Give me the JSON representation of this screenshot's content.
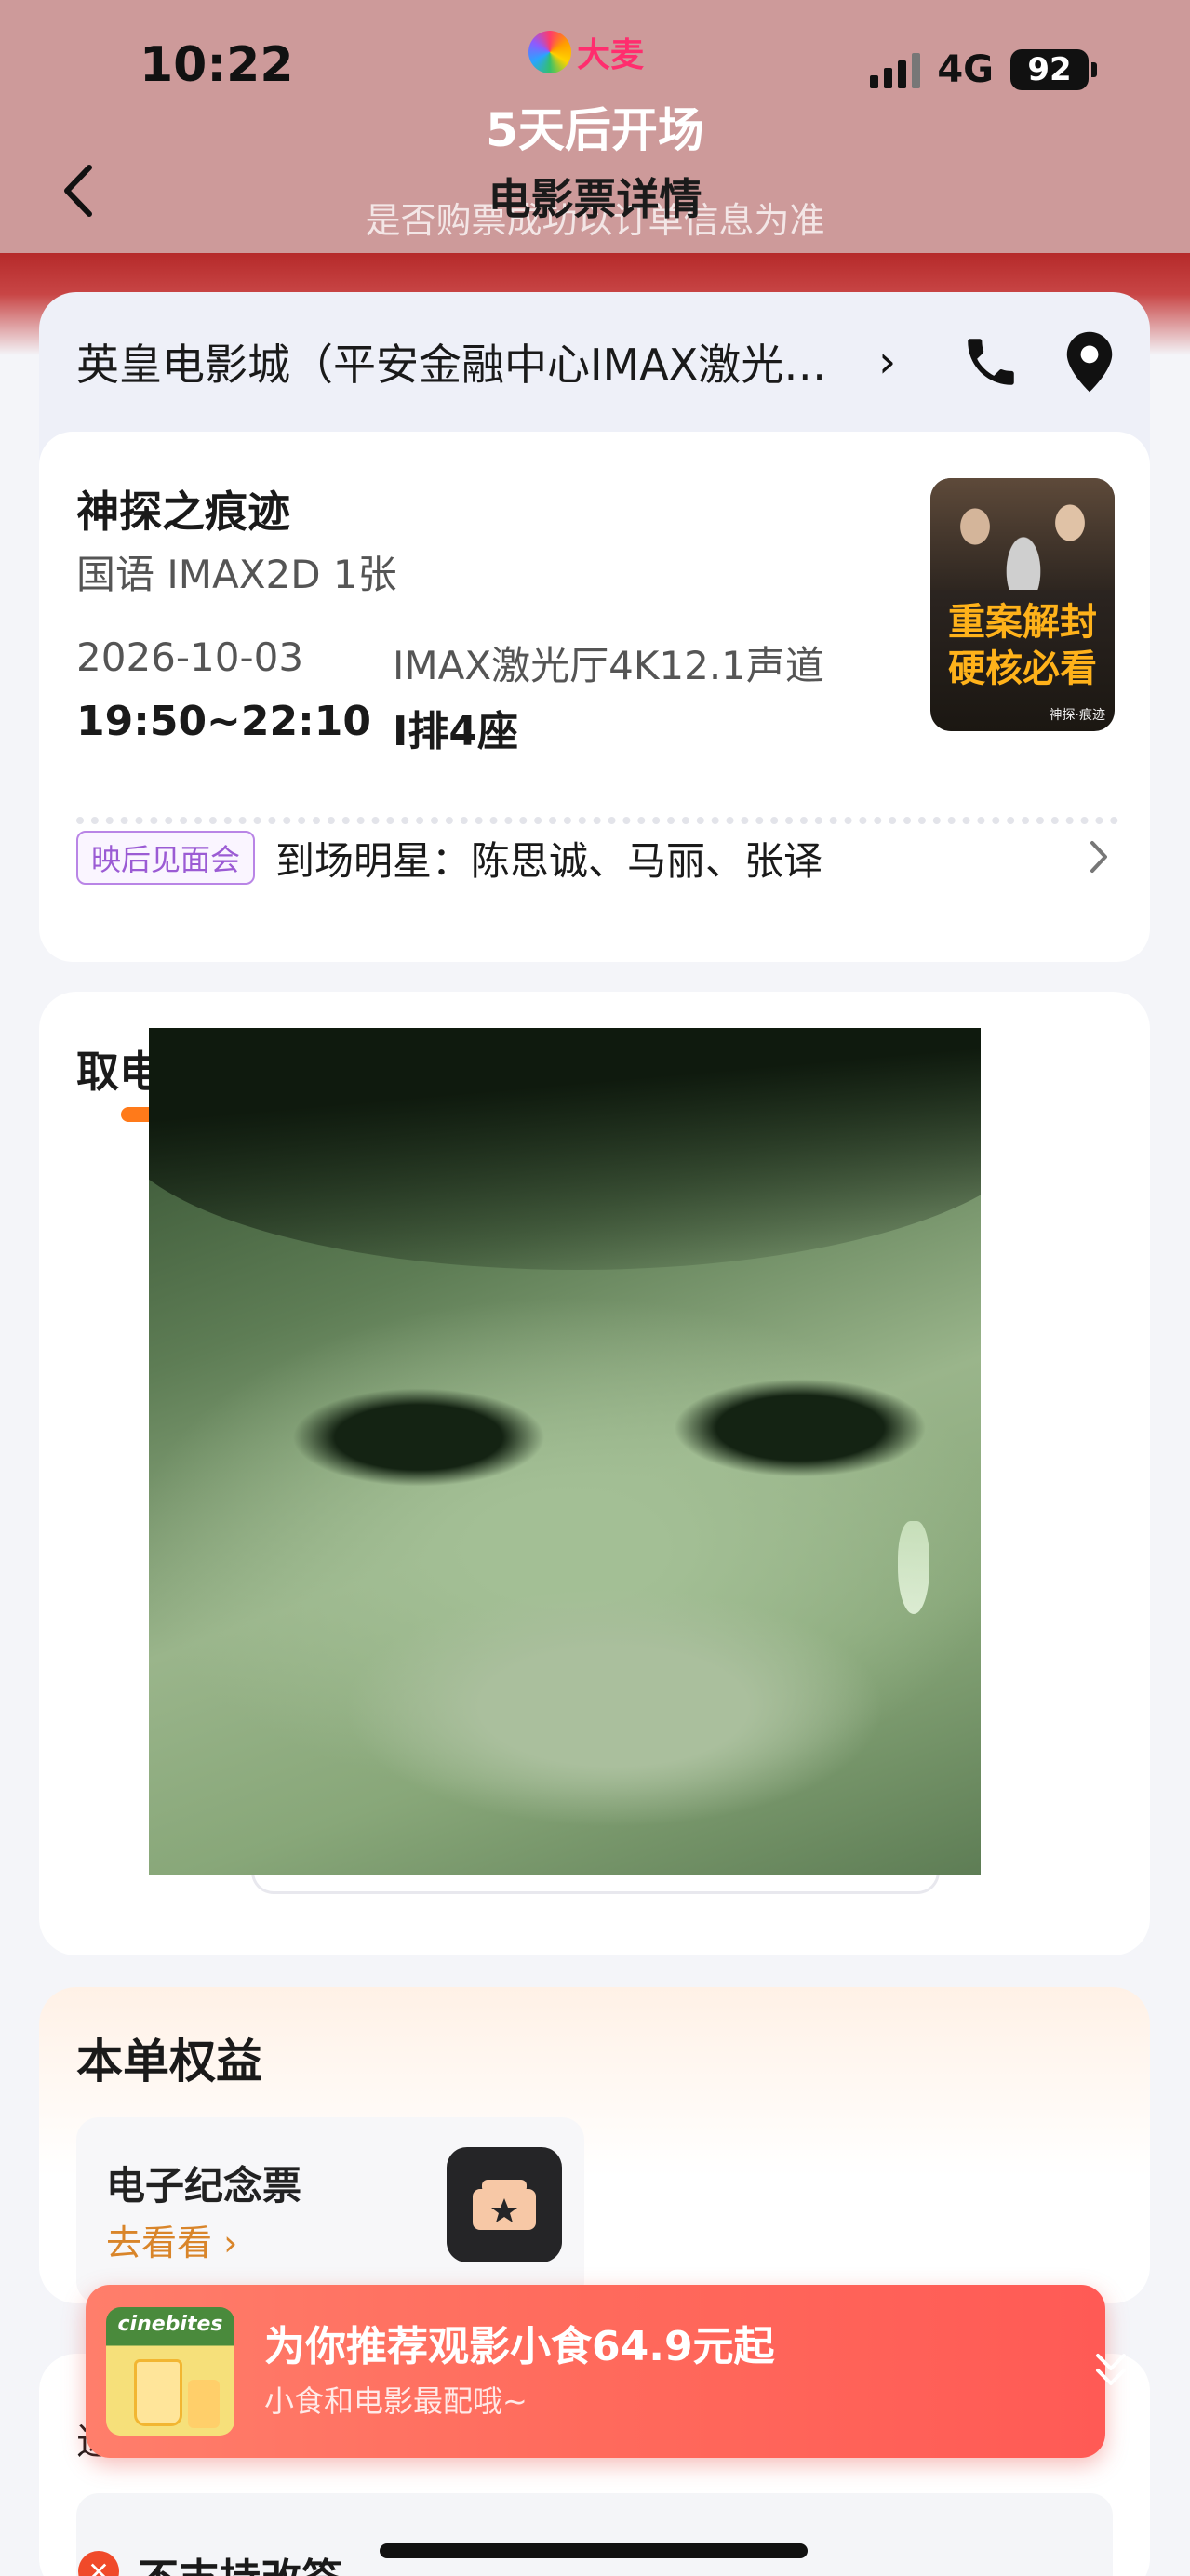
{
  "status_bar": {
    "time": "10:22",
    "network": "4G",
    "battery": "92"
  },
  "brand": {
    "name": "大麦"
  },
  "header": {
    "countdown": "5天后开场",
    "title": "电影票详情",
    "note": "是否购票成功以订单信息为准"
  },
  "cinema": {
    "name": "英皇电影城（平安金融中心IMAX激光…",
    "chevron": "›"
  },
  "ticket": {
    "movie_title": "神探之痕迹",
    "meta": "国语 IMAX2D 1张",
    "date": "2026-10-03",
    "time": "19:50~22:10",
    "hall": "IMAX激光厅4K12.1声道",
    "seat": "I排4座",
    "poster": {
      "line1": "重案解封",
      "line2": "硬核必看",
      "sub": "神探·痕迹"
    }
  },
  "event": {
    "tag": "映后见面会",
    "text": "到场明星：陈思诚、马丽、张译"
  },
  "pickup": {
    "title": "取电"
  },
  "benefits": {
    "title": "本单权益",
    "souvenir_title": "电子纪念票",
    "souvenir_link": "去看看 ›"
  },
  "refund": {
    "label_stub": "退",
    "text": "不支持改签"
  },
  "snack_banner": {
    "logo_text": "cinebites",
    "title": "为你推荐观影小食64.9元起",
    "subtitle": "小食和电影最配哦~"
  },
  "colors": {
    "header_bg": "#cd9a9a",
    "band_red": "#b52a2a",
    "accent_orange": "#ff7a1a",
    "event_purple": "#9b5bd4",
    "banner_red": "#ff5a55"
  }
}
